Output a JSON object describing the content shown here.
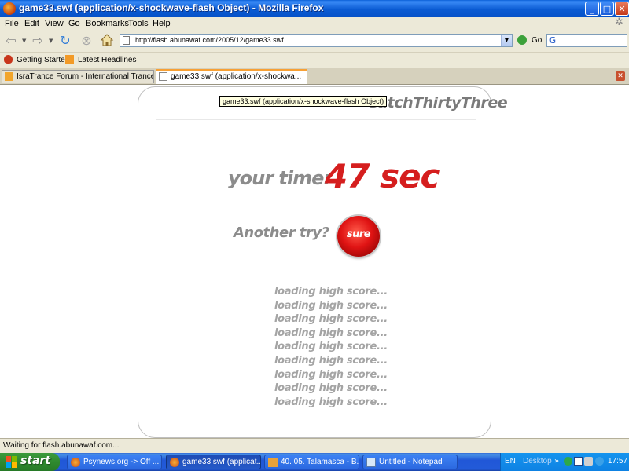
{
  "window": {
    "title": "game33.swf (application/x-shockwave-flash Object) - Mozilla Firefox",
    "minimize": "_",
    "maximize": "□",
    "close": "✕"
  },
  "menu": {
    "items": [
      {
        "label": "File"
      },
      {
        "label": "Edit"
      },
      {
        "label": "View"
      },
      {
        "label": "Go"
      },
      {
        "label": "Bookmarks"
      },
      {
        "label": "Tools"
      },
      {
        "label": "Help"
      }
    ]
  },
  "navigation": {
    "url": "http://flash.abunawaf.com/2005/12/game33.swf",
    "go_label": "Go",
    "search_value": ""
  },
  "bookmarks": {
    "items": [
      {
        "label": "Getting Started",
        "icon": "firefox-bookmark-icon"
      },
      {
        "label": "Latest Headlines",
        "icon": "rss-feed-icon"
      }
    ]
  },
  "tabs": [
    {
      "label": "IsraTrance Forum - International Trance Co...",
      "active": false
    },
    {
      "label": "game33.swf (application/x-shockwa...",
      "active": true
    }
  ],
  "page": {
    "tooltip": "game33.swf (application/x-shockwave-flash Object)",
    "game_title": "CatchThirtyThree",
    "your_time_label": "your time:",
    "time_value": "47 sec",
    "another_try_label": "Another try?",
    "sure_button": "sure",
    "score_lines": [
      "loading high score...",
      "loading high score...",
      "loading high score...",
      "loading high score...",
      "loading high score...",
      "loading high score...",
      "loading high score...",
      "loading high score...",
      "loading high score..."
    ],
    "colors": {
      "accent_red": "#D51E1E",
      "label_gray": "#8C8C8C"
    }
  },
  "status": {
    "text": "Waiting for flash.abunawaf.com..."
  },
  "taskbar": {
    "start_label": "start",
    "tasks": [
      {
        "label": "Psynews.org -> Off ...",
        "active": false
      },
      {
        "label": "game33.swf (applicat...",
        "active": true
      },
      {
        "label": "40. 05. Talamasca - B...",
        "active": false
      },
      {
        "label": "Untitled - Notepad",
        "active": false
      }
    ],
    "language": "EN",
    "desktop_label": "Desktop",
    "clock": "17:57"
  }
}
